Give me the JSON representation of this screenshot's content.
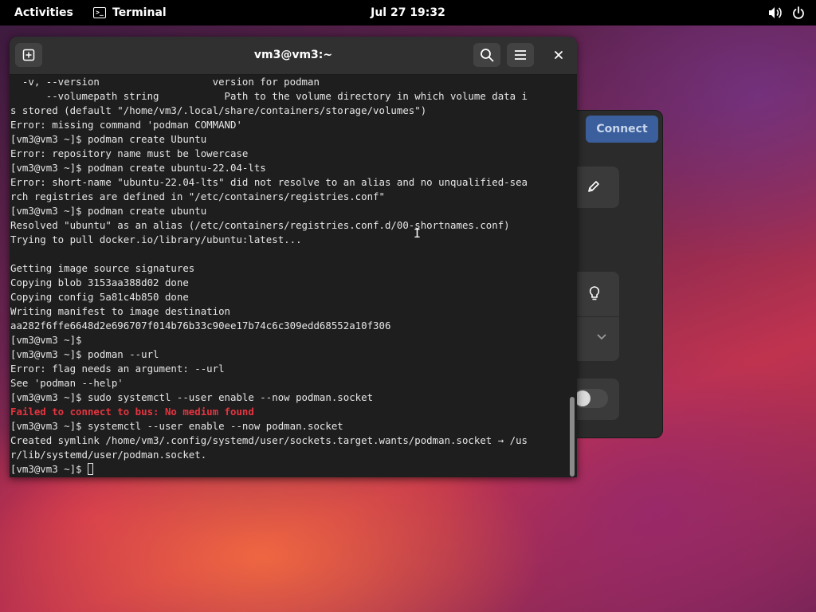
{
  "topbar": {
    "activities": "Activities",
    "app_name": "Terminal",
    "clock": "Jul 27  19:32",
    "volume_icon": "speaker-icon",
    "power_icon": "power-icon"
  },
  "background_window": {
    "connect_label": "Connect",
    "icons": [
      "pencil-icon",
      "lightbulb-icon",
      "chevron-down-icon",
      "toggle-switch-icon"
    ]
  },
  "terminal": {
    "title": "vm3@vm3:~",
    "new_tab_icon": "new-tab-icon",
    "search_icon": "search-icon",
    "menu_icon": "hamburger-menu-icon",
    "close_icon": "close-icon",
    "lines": [
      {
        "text": "  -v, --version                   version for podman",
        "error": false
      },
      {
        "text": "      --volumepath string           Path to the volume directory in which volume data i",
        "error": false
      },
      {
        "text": "s stored (default \"/home/vm3/.local/share/containers/storage/volumes\")",
        "error": false
      },
      {
        "text": "Error: missing command 'podman COMMAND'",
        "error": false
      },
      {
        "text": "[vm3@vm3 ~]$ podman create Ubuntu",
        "error": false
      },
      {
        "text": "Error: repository name must be lowercase",
        "error": false
      },
      {
        "text": "[vm3@vm3 ~]$ podman create ubuntu-22.04-lts",
        "error": false
      },
      {
        "text": "Error: short-name \"ubuntu-22.04-lts\" did not resolve to an alias and no unqualified-sea",
        "error": false
      },
      {
        "text": "rch registries are defined in \"/etc/containers/registries.conf\"",
        "error": false
      },
      {
        "text": "[vm3@vm3 ~]$ podman create ubuntu",
        "error": false
      },
      {
        "text": "Resolved \"ubuntu\" as an alias (/etc/containers/registries.conf.d/00-shortnames.conf)",
        "error": false
      },
      {
        "text": "Trying to pull docker.io/library/ubuntu:latest...",
        "error": false
      },
      {
        "text": "",
        "error": false
      },
      {
        "text": "Getting image source signatures",
        "error": false
      },
      {
        "text": "Copying blob 3153aa388d02 done",
        "error": false
      },
      {
        "text": "Copying config 5a81c4b850 done",
        "error": false
      },
      {
        "text": "Writing manifest to image destination",
        "error": false
      },
      {
        "text": "aa282f6ffe6648d2e696707f014b76b33c90ee17b74c6c309edd68552a10f306",
        "error": false
      },
      {
        "text": "[vm3@vm3 ~]$",
        "error": false
      },
      {
        "text": "[vm3@vm3 ~]$ podman --url",
        "error": false
      },
      {
        "text": "Error: flag needs an argument: --url",
        "error": false
      },
      {
        "text": "See 'podman --help'",
        "error": false
      },
      {
        "text": "[vm3@vm3 ~]$ sudo systemctl --user enable --now podman.socket",
        "error": false
      },
      {
        "text": "Failed to connect to bus: No medium found",
        "error": true
      },
      {
        "text": "[vm3@vm3 ~]$ systemctl --user enable --now podman.socket",
        "error": false
      },
      {
        "text": "Created symlink /home/vm3/.config/systemd/user/sockets.target.wants/podman.socket → /us",
        "error": false
      },
      {
        "text": "r/lib/systemd/user/podman.socket.",
        "error": false
      }
    ],
    "prompt": "[vm3@vm3 ~]$ "
  },
  "colors": {
    "error_text": "#e5343f",
    "terminal_bg": "#1e1e1e",
    "header_bg": "#303030",
    "accent_button": "#3a5f9c"
  }
}
